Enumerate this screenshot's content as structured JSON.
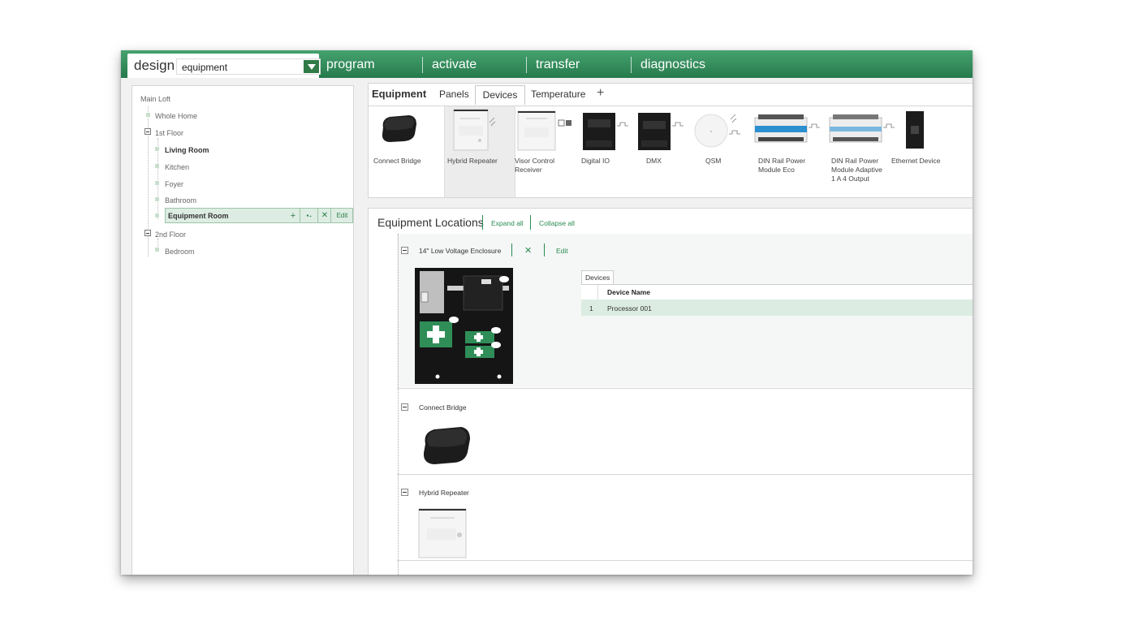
{
  "nav": {
    "design_label": "design",
    "design_select_value": "equipment",
    "items": [
      "program",
      "activate",
      "transfer",
      "diagnostics"
    ]
  },
  "tree": {
    "root": "Main Loft",
    "items": [
      {
        "label": "Whole Home"
      },
      {
        "label": "1st Floor"
      },
      {
        "label": "Living Room"
      },
      {
        "label": "Kitchen"
      },
      {
        "label": "Foyer"
      },
      {
        "label": "Bathroom"
      },
      {
        "label": "Equipment Room"
      },
      {
        "label": "2nd Floor"
      },
      {
        "label": "Bedroom"
      }
    ],
    "selected_actions": {
      "add": "+",
      "add_child": "▪₊",
      "delete": "✕",
      "edit": "Edit"
    }
  },
  "equipment": {
    "title": "Equipment",
    "tabs": [
      "Panels",
      "Devices",
      "Temperature"
    ],
    "add_tab": "+",
    "active_tab": "Devices",
    "devices": [
      {
        "label": "Connect Bridge"
      },
      {
        "label": "Hybrid Repeater"
      },
      {
        "label": "Visor Control\nReceiver"
      },
      {
        "label": "Digital IO"
      },
      {
        "label": "DMX"
      },
      {
        "label": "QSM"
      },
      {
        "label": "DIN Rail Power\nModule Eco"
      },
      {
        "label": "DIN Rail Power\nModule Adaptive\n1 A 4 Output"
      },
      {
        "label": "Ethernet Device"
      }
    ]
  },
  "locations": {
    "title": "Equipment Locations",
    "expand_all": "Expand all",
    "collapse_all": "Collapse all",
    "sections": [
      {
        "label": "14\" Low Voltage Enclosure",
        "delete": "✕",
        "edit": "Edit"
      },
      {
        "label": "Connect Bridge"
      },
      {
        "label": "Hybrid Repeater"
      }
    ],
    "devices_tab": "Devices",
    "table": {
      "header": "Device Name",
      "rows": [
        {
          "num": "1",
          "name": "Processor 001"
        }
      ]
    }
  },
  "colors": {
    "brand_green": "#267a4c",
    "accent_green": "#2a8b52",
    "selected_bg": "#deede3"
  }
}
